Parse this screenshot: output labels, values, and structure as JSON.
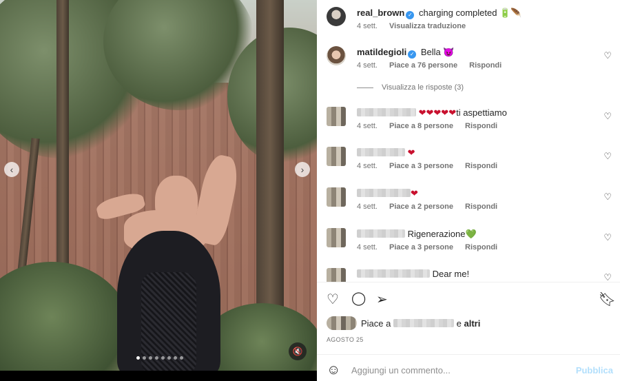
{
  "comments": [
    {
      "username": "real_brown",
      "text": "charging completed",
      "emoji": "🔋🪶",
      "time": "4 sett.",
      "translate": "Visualizza traduzione"
    },
    {
      "username": "matildegioli",
      "text": "Bella",
      "emoji": "😈",
      "time": "4 sett.",
      "likes": "Piace a 76 persone",
      "reply": "Rispondi",
      "view_replies": "Visualizza le risposte (3)"
    },
    {
      "text": "ti aspettiamo",
      "emoji": "❤❤❤❤❤",
      "time": "4 sett.",
      "likes": "Piace a 8 persone",
      "reply": "Rispondi"
    },
    {
      "emoji": "❤",
      "time": "4 sett.",
      "likes": "Piace a 3 persone",
      "reply": "Rispondi"
    },
    {
      "emoji": "❤",
      "time": "4 sett.",
      "likes": "Piace a 2 persone",
      "reply": "Rispondi"
    },
    {
      "text": "Rigenerazione",
      "emoji": "💚",
      "time": "4 sett.",
      "likes": "Piace a 3 persone",
      "reply": "Rispondi"
    },
    {
      "text": "Dear me!"
    }
  ],
  "likes_bar": {
    "prefix": "Piace a",
    "middle": "e",
    "others": "altri"
  },
  "post_date": "AGOSTO 25",
  "add_comment": {
    "placeholder": "Aggiungi un commento...",
    "publish": "Pubblica"
  },
  "colors": {
    "verified": "#3897f0",
    "heart_red": "#c8102e",
    "publish_disabled": "#b2dffc"
  },
  "icons": [
    "heart-icon",
    "comment-icon",
    "share-icon",
    "bookmark-icon",
    "smile-icon",
    "mute-icon",
    "chevron-left-icon",
    "chevron-right-icon",
    "verified-icon"
  ]
}
